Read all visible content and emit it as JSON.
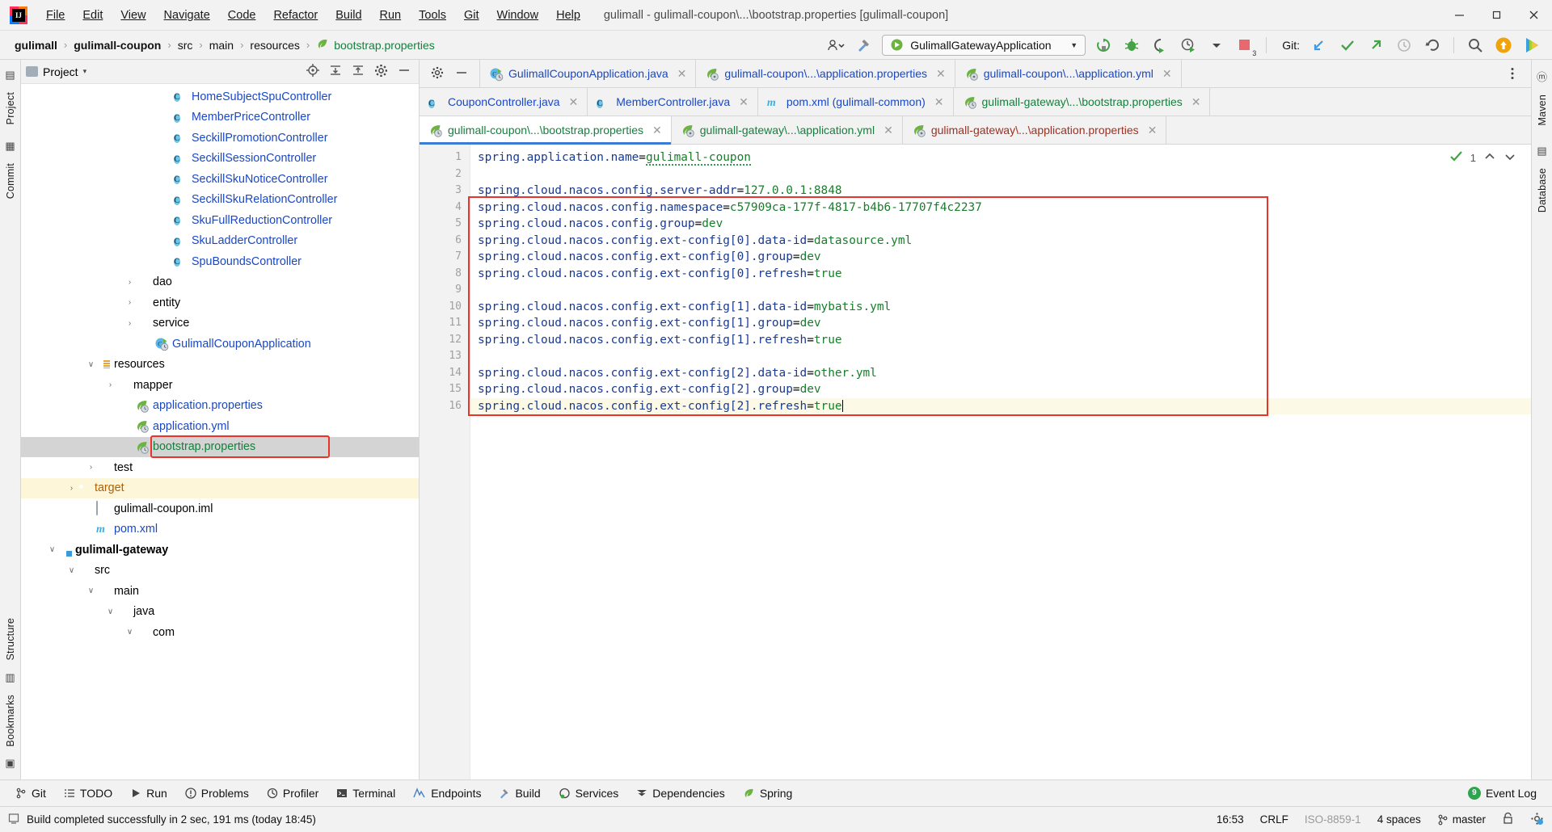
{
  "window": {
    "title": "gulimall - gulimall-coupon\\...\\bootstrap.properties [gulimall-coupon]",
    "minimize": "—",
    "maximize": "❐",
    "close": "✕",
    "logo_text": "IJ"
  },
  "menu": [
    {
      "label": "File"
    },
    {
      "label": "Edit"
    },
    {
      "label": "View"
    },
    {
      "label": "Navigate"
    },
    {
      "label": "Code"
    },
    {
      "label": "Refactor"
    },
    {
      "label": "Build"
    },
    {
      "label": "Run"
    },
    {
      "label": "Tools"
    },
    {
      "label": "Git"
    },
    {
      "label": "Window"
    },
    {
      "label": "Help"
    }
  ],
  "navbar": {
    "breadcrumbs": [
      {
        "label": "gulimall",
        "style": "bold"
      },
      {
        "label": "gulimall-coupon",
        "style": "bold"
      },
      {
        "label": "src",
        "style": "plain"
      },
      {
        "label": "main",
        "style": "plain"
      },
      {
        "label": "resources",
        "style": "plain"
      },
      {
        "label": "bootstrap.properties",
        "style": "green"
      }
    ],
    "separator": "›",
    "run_config": "GulimallGatewayApplication",
    "git_label": "Git:",
    "icons": {
      "user_settings": "user-settings-icon",
      "hammer": "build-hammer-icon",
      "rerun": "rerun-icon",
      "debug": "debug-icon",
      "run_coverage": "run-with-coverage-icon",
      "profiler": "profiler-icon",
      "stop": "stop-icon",
      "stop_badge": "3",
      "git_update": "git-update-project-icon",
      "git_commit": "git-commit-icon",
      "git_push": "git-push-icon",
      "git_history": "git-history-icon",
      "git_rollback": "git-rollback-icon",
      "search": "search-everywhere-icon",
      "updates": "updates-available-icon",
      "ide_feature": "ide-feature-icon"
    }
  },
  "left_rail": [
    "Project",
    "Commit",
    "Structure",
    "Bookmarks"
  ],
  "right_rail": [
    "Maven",
    "Database"
  ],
  "project_panel": {
    "title": "Project",
    "dropdown_caret": "▾",
    "icons": {
      "locate": "locate-file-icon",
      "expand": "expand-all-icon",
      "collapse": "collapse-all-icon",
      "settings": "gear-icon",
      "hide": "hide-panel-icon"
    },
    "tree": [
      {
        "label": "HomeSubjectSpuController",
        "icon": "class",
        "indent": 7,
        "arrow": "",
        "style": "blue"
      },
      {
        "label": "MemberPriceController",
        "icon": "class",
        "indent": 7,
        "arrow": "",
        "style": "blue"
      },
      {
        "label": "SeckillPromotionController",
        "icon": "class",
        "indent": 7,
        "arrow": "",
        "style": "blue"
      },
      {
        "label": "SeckillSessionController",
        "icon": "class",
        "indent": 7,
        "arrow": "",
        "style": "blue"
      },
      {
        "label": "SeckillSkuNoticeController",
        "icon": "class",
        "indent": 7,
        "arrow": "",
        "style": "blue"
      },
      {
        "label": "SeckillSkuRelationController",
        "icon": "class",
        "indent": 7,
        "arrow": "",
        "style": "blue"
      },
      {
        "label": "SkuFullReductionController",
        "icon": "class",
        "indent": 7,
        "arrow": "",
        "style": "blue"
      },
      {
        "label": "SkuLadderController",
        "icon": "class",
        "indent": 7,
        "arrow": "",
        "style": "blue"
      },
      {
        "label": "SpuBoundsController",
        "icon": "class",
        "indent": 7,
        "arrow": "",
        "style": "blue"
      },
      {
        "label": "dao",
        "icon": "folder",
        "indent": 5,
        "arrow": "›",
        "style": "plain"
      },
      {
        "label": "entity",
        "icon": "folder",
        "indent": 5,
        "arrow": "›",
        "style": "plain"
      },
      {
        "label": "service",
        "icon": "folder",
        "indent": 5,
        "arrow": "›",
        "style": "plain"
      },
      {
        "label": "GulimallCouponApplication",
        "icon": "spring-run",
        "indent": 6,
        "arrow": "",
        "style": "blue"
      },
      {
        "label": "resources",
        "icon": "resources",
        "indent": 3,
        "arrow": "∨",
        "style": "plain"
      },
      {
        "label": "mapper",
        "icon": "folder-plain",
        "indent": 4,
        "arrow": "›",
        "style": "plain"
      },
      {
        "label": "application.properties",
        "icon": "spring-leaf",
        "indent": 5,
        "arrow": "",
        "style": "blue"
      },
      {
        "label": "application.yml",
        "icon": "spring-leaf",
        "indent": 5,
        "arrow": "",
        "style": "blue"
      },
      {
        "label": "bootstrap.properties",
        "icon": "spring-leaf",
        "indent": 5,
        "arrow": "",
        "style": "green",
        "selected": true,
        "boxed": true
      },
      {
        "label": "test",
        "icon": "folder-plain",
        "indent": 3,
        "arrow": "›",
        "style": "plain"
      },
      {
        "label": "target",
        "icon": "target",
        "indent": 2,
        "arrow": "›",
        "style": "orange",
        "highlight": true
      },
      {
        "label": "gulimall-coupon.iml",
        "icon": "iml",
        "indent": 3,
        "arrow": "",
        "style": "plain"
      },
      {
        "label": "pom.xml",
        "icon": "maven",
        "indent": 3,
        "arrow": "",
        "style": "blue"
      },
      {
        "label": "gulimall-gateway",
        "icon": "module",
        "indent": 1,
        "arrow": "∨",
        "style": "bold"
      },
      {
        "label": "src",
        "icon": "folder-plain",
        "indent": 2,
        "arrow": "∨",
        "style": "plain"
      },
      {
        "label": "main",
        "icon": "folder-plain",
        "indent": 3,
        "arrow": "∨",
        "style": "plain"
      },
      {
        "label": "java",
        "icon": "folder-plain",
        "indent": 4,
        "arrow": "∨",
        "style": "plain"
      },
      {
        "label": "com",
        "icon": "folder-plain",
        "indent": 5,
        "arrow": "∨",
        "style": "plain"
      }
    ]
  },
  "editor": {
    "tab_rows": [
      [
        {
          "label": "GulimallCouponApplication.java",
          "icon": "spring-run",
          "color": "blue",
          "close": "✕"
        },
        {
          "label": "gulimall-coupon\\...\\application.properties",
          "icon": "spring-leaf-prop",
          "color": "blue",
          "close": "✕"
        },
        {
          "label": "gulimall-coupon\\...\\application.yml",
          "icon": "spring-leaf-prop",
          "color": "blue",
          "close": "✕"
        }
      ],
      [
        {
          "label": "CouponController.java",
          "icon": "class",
          "color": "blue",
          "close": "✕"
        },
        {
          "label": "MemberController.java",
          "icon": "class",
          "color": "blue",
          "close": "✕"
        },
        {
          "label": "pom.xml (gulimall-common)",
          "icon": "maven",
          "color": "blue",
          "close": "✕"
        },
        {
          "label": "gulimall-gateway\\...\\bootstrap.properties",
          "icon": "spring-leaf",
          "color": "green",
          "close": "✕"
        }
      ],
      [
        {
          "label": "gulimall-coupon\\...\\bootstrap.properties",
          "icon": "spring-leaf",
          "color": "green",
          "close": "✕",
          "active": true
        },
        {
          "label": "gulimall-gateway\\...\\application.yml",
          "icon": "spring-leaf-prop",
          "color": "green",
          "close": "✕"
        },
        {
          "label": "gulimall-gateway\\...\\application.properties",
          "icon": "spring-leaf-prop",
          "color": "red",
          "close": "✕"
        }
      ]
    ],
    "inspection": {
      "count": "1",
      "ok_icon": "inspection-ok-icon",
      "prev_icon": "prev-highlight-icon",
      "next_icon": "next-highlight-icon"
    },
    "line_numbers": [
      "1",
      "2",
      "3",
      "4",
      "5",
      "6",
      "7",
      "8",
      "9",
      "10",
      "11",
      "12",
      "13",
      "14",
      "15",
      "16"
    ],
    "lines": [
      {
        "n": 1,
        "key": "spring.application.name",
        "val": "gulimall-coupon",
        "squiggle": true
      },
      {
        "n": 2,
        "key": "",
        "val": ""
      },
      {
        "n": 3,
        "key": "spring.cloud.nacos.config.server-addr",
        "val": "127.0.0.1:8848"
      },
      {
        "n": 4,
        "key": "spring.cloud.nacos.config.namespace",
        "val": "c57909ca-177f-4817-b4b6-17707f4c2237"
      },
      {
        "n": 5,
        "key": "spring.cloud.nacos.config.group",
        "val": "dev"
      },
      {
        "n": 6,
        "key": "spring.cloud.nacos.config.ext-config[0].data-id",
        "val": "datasource.yml"
      },
      {
        "n": 7,
        "key": "spring.cloud.nacos.config.ext-config[0].group",
        "val": "dev"
      },
      {
        "n": 8,
        "key": "spring.cloud.nacos.config.ext-config[0].refresh",
        "val": "true"
      },
      {
        "n": 9,
        "key": "",
        "val": ""
      },
      {
        "n": 10,
        "key": "spring.cloud.nacos.config.ext-config[1].data-id",
        "val": "mybatis.yml"
      },
      {
        "n": 11,
        "key": "spring.cloud.nacos.config.ext-config[1].group",
        "val": "dev"
      },
      {
        "n": 12,
        "key": "spring.cloud.nacos.config.ext-config[1].refresh",
        "val": "true"
      },
      {
        "n": 13,
        "key": "",
        "val": ""
      },
      {
        "n": 14,
        "key": "spring.cloud.nacos.config.ext-config[2].data-id",
        "val": "other.yml"
      },
      {
        "n": 15,
        "key": "spring.cloud.nacos.config.ext-config[2].group",
        "val": "dev"
      },
      {
        "n": 16,
        "key": "spring.cloud.nacos.config.ext-config[2].refresh",
        "val": "true",
        "current": true,
        "caret": true
      }
    ]
  },
  "tool_windows": [
    {
      "label": "Git",
      "icon": "git-branch-icon"
    },
    {
      "label": "TODO",
      "icon": "todo-list-icon"
    },
    {
      "label": "Run",
      "icon": "run-play-icon"
    },
    {
      "label": "Problems",
      "icon": "problems-icon"
    },
    {
      "label": "Profiler",
      "icon": "profiler-icon"
    },
    {
      "label": "Terminal",
      "icon": "terminal-icon"
    },
    {
      "label": "Endpoints",
      "icon": "endpoints-icon"
    },
    {
      "label": "Build",
      "icon": "build-hammer-icon"
    },
    {
      "label": "Services",
      "icon": "services-icon"
    },
    {
      "label": "Dependencies",
      "icon": "dependencies-icon"
    },
    {
      "label": "Spring",
      "icon": "spring-leaf-icon"
    }
  ],
  "event_log": {
    "label": "Event Log",
    "badge": "9"
  },
  "statusbar": {
    "message": "Build completed successfully in 2 sec, 191 ms (today 18:45)",
    "time": "16:53",
    "line_sep": "CRLF",
    "encoding": "ISO-8859-1",
    "indent": "4 spaces",
    "branch": "master",
    "lock_icon": "read-write-lock-icon",
    "inspection_icon": "inspection-level-icon"
  },
  "colors": {
    "accent_blue": "#3a7bd5",
    "link_blue": "#1a48c4",
    "green": "#15803d",
    "red_box": "#e8342a",
    "selection": "#d4d4d4",
    "highlight": "#fdf6d8"
  }
}
